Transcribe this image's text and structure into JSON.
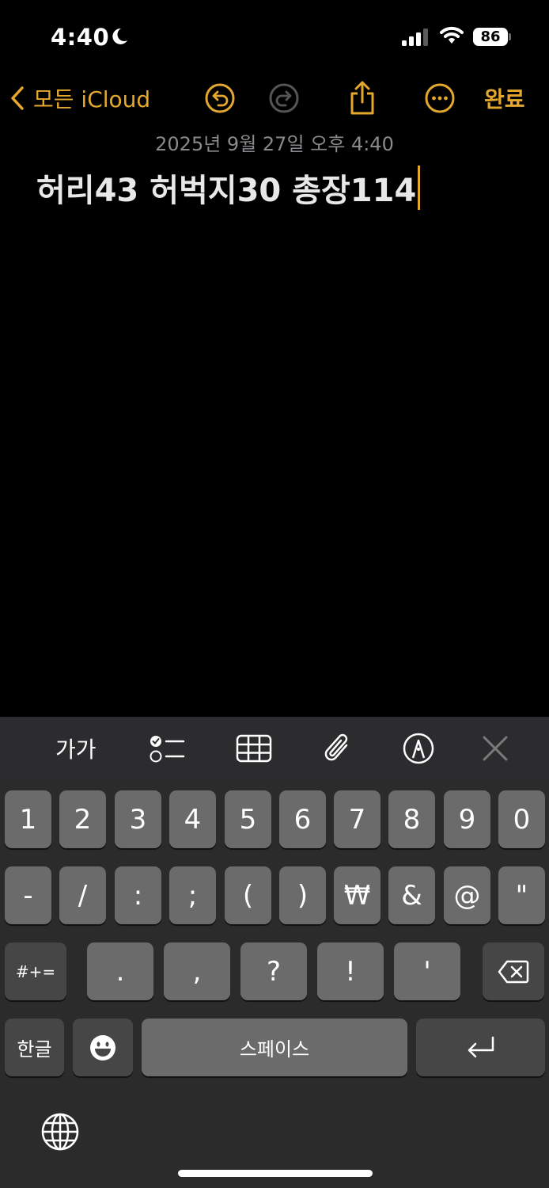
{
  "status": {
    "time": "4:40",
    "battery": "86",
    "icons": [
      "moon-icon",
      "signal-icon",
      "wifi-icon",
      "battery-icon"
    ]
  },
  "nav": {
    "back_label": "모든 iCloud",
    "done_label": "완료",
    "icons": [
      "chevron-left-icon",
      "undo-icon",
      "redo-icon",
      "share-icon",
      "more-icon"
    ]
  },
  "note": {
    "date": "2025년 9월 27일 오후 4:40",
    "text": "허리43 허벅지30 총장114"
  },
  "toolbar": {
    "format_label": "가가",
    "icons": [
      "checklist-icon",
      "table-icon",
      "attachment-icon",
      "markup-icon",
      "close-icon"
    ]
  },
  "keyboard": {
    "row1": [
      "1",
      "2",
      "3",
      "4",
      "5",
      "6",
      "7",
      "8",
      "9",
      "0"
    ],
    "row2": [
      "-",
      "/",
      ":",
      ";",
      "(",
      ")",
      "₩",
      "&",
      "@",
      "\""
    ],
    "row3_left": "#+=",
    "row3": [
      ".",
      ",",
      "?",
      "!",
      "'"
    ],
    "lang_label": "한글",
    "space_label": "스페이스",
    "icons": [
      "delete-icon",
      "emoji-icon",
      "return-icon",
      "globe-icon"
    ]
  },
  "colors": {
    "accent": "#e5a82e",
    "background": "#000000",
    "key": "#6b6b6b",
    "key_dark": "#464646",
    "keyboard_bg": "#2b2b2b"
  }
}
